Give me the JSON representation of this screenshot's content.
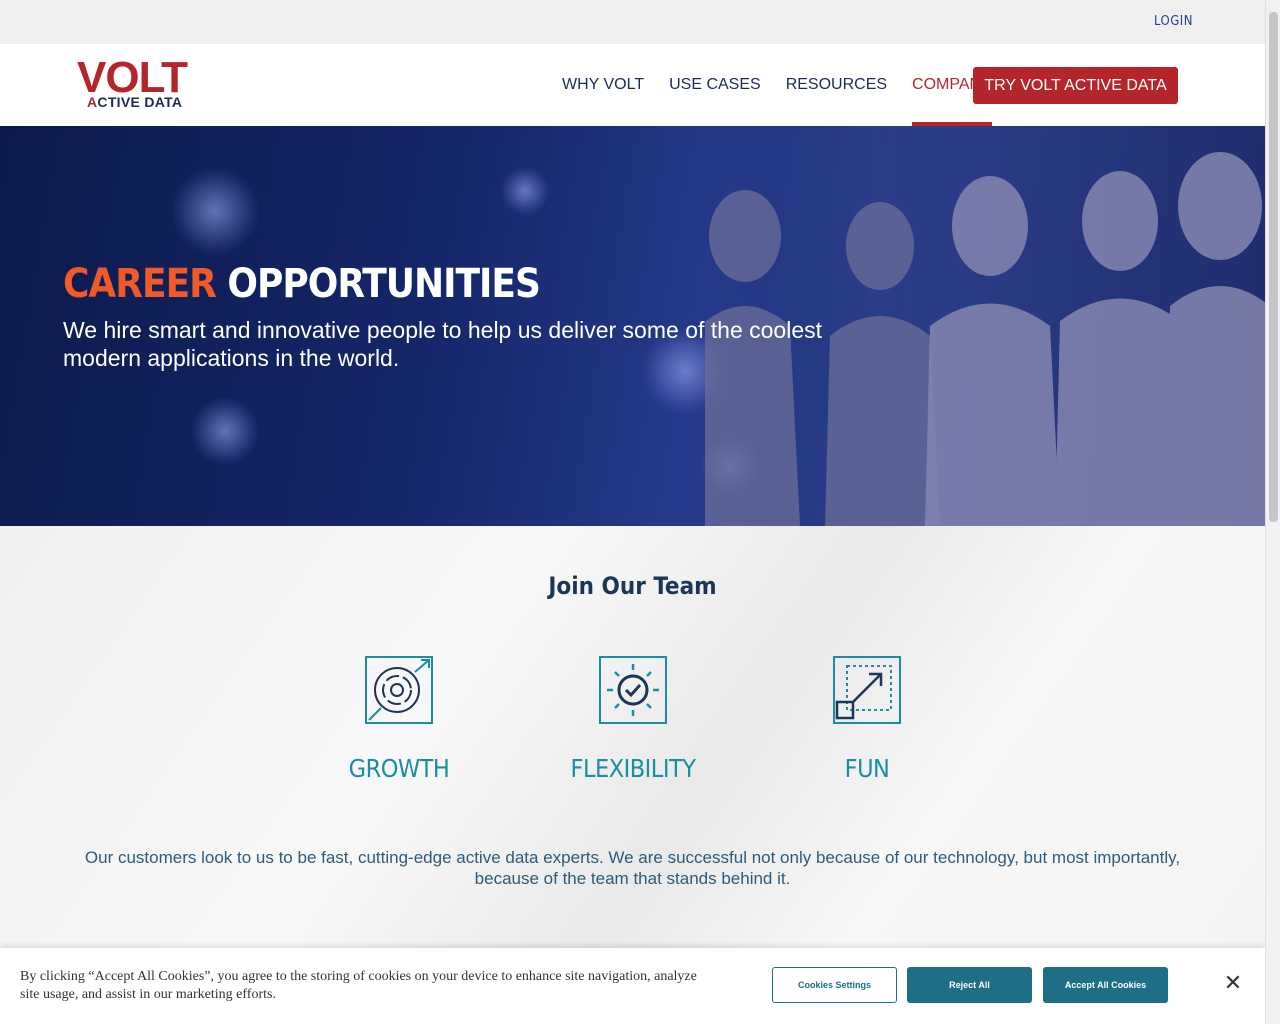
{
  "utility": {
    "login_label": "LOGIN"
  },
  "header": {
    "logo_main": "VOLT",
    "logo_sub_first": "A",
    "logo_sub_rest": "CTIVE DATA",
    "nav": [
      {
        "label": "WHY VOLT",
        "active": false
      },
      {
        "label": "USE CASES",
        "active": false
      },
      {
        "label": "RESOURCES",
        "active": false
      },
      {
        "label": "COMPANY",
        "active": true
      }
    ],
    "cta_label": "TRY VOLT ACTIVE DATA"
  },
  "hero": {
    "title_accent": "CAREER",
    "title_rest": "OPPORTUNITIES",
    "subtitle": "We hire smart and innovative people to help us deliver some of the coolest modern applications in the world."
  },
  "team": {
    "heading": "Join Our Team",
    "features": [
      {
        "label": "GROWTH",
        "icon": "growth-target-icon"
      },
      {
        "label": "FLEXIBILITY",
        "icon": "flexibility-check-icon"
      },
      {
        "label": "FUN",
        "icon": "fun-expand-icon"
      }
    ],
    "description": "Our customers look to us to be fast, cutting-edge active data experts. We are successful not only because of our technology, but most importantly, because of the team that stands behind it."
  },
  "cookie": {
    "text": "By clicking “Accept All Cookies”, you agree to the storing of cookies on your device to enhance site navigation, analyze site usage, and assist in our marketing efforts.",
    "settings_label": "Cookies Settings",
    "reject_label": "Reject All",
    "accept_label": "Accept All Cookies",
    "close_glyph": "✕"
  },
  "colors": {
    "brand_red": "#b5262c",
    "brand_navy": "#1d2a5a",
    "accent_orange": "#f05a28",
    "teal": "#1a8ea0",
    "cookie_teal": "#1e6e86"
  }
}
